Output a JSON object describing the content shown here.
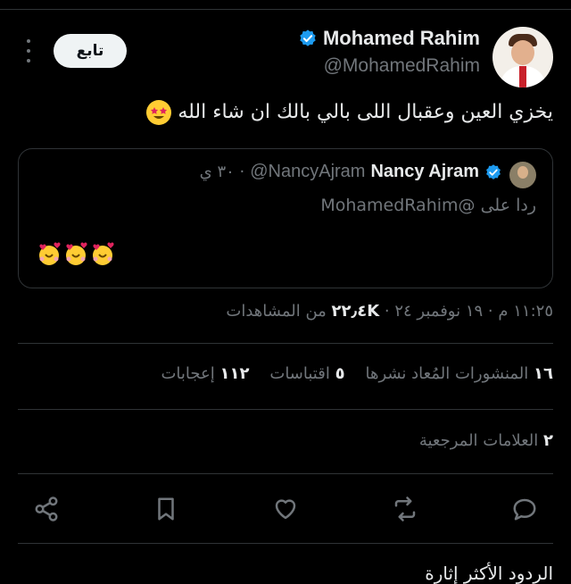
{
  "author": {
    "name": "Mohamed Rahim",
    "handle": "@MohamedRahim"
  },
  "follow_label": "تابع",
  "tweet_text": "يخزي العين وعقبال اللى بالي بالك ان شاء الله",
  "quoted": {
    "name": "Nancy Ajram",
    "handle": "@NancyAjram",
    "time": "· ٣٠ ي",
    "reply_to": "ردا على @MohamedRahim"
  },
  "meta": {
    "time": "١١:٢٥ م",
    "date": "١٩ نوفمبر ٢٤",
    "views_count": "٢٢٫٤K",
    "views_label": "من المشاهدات"
  },
  "stats": {
    "reposts_count": "١٦",
    "reposts_label": "المنشورات المُعاد نشرها",
    "quotes_count": "٥",
    "quotes_label": "اقتباسات",
    "likes_count": "١١٢",
    "likes_label": "إعجابات"
  },
  "bookmarks": {
    "count": "٢",
    "label": "العلامات المرجعية"
  },
  "bottom_text": "الردود الأكثر إثارة",
  "icons": {
    "verified": "verified-badge-icon",
    "share": "share-icon",
    "bookmark": "bookmark-icon",
    "like": "heart-icon",
    "repost": "repost-icon",
    "reply": "reply-icon",
    "more": "more-vertical-icon"
  },
  "colors": {
    "background": "#000000",
    "verified": "#1d9bf0",
    "muted": "#71767b",
    "text": "#e7e9ea",
    "border": "#2f3336"
  }
}
